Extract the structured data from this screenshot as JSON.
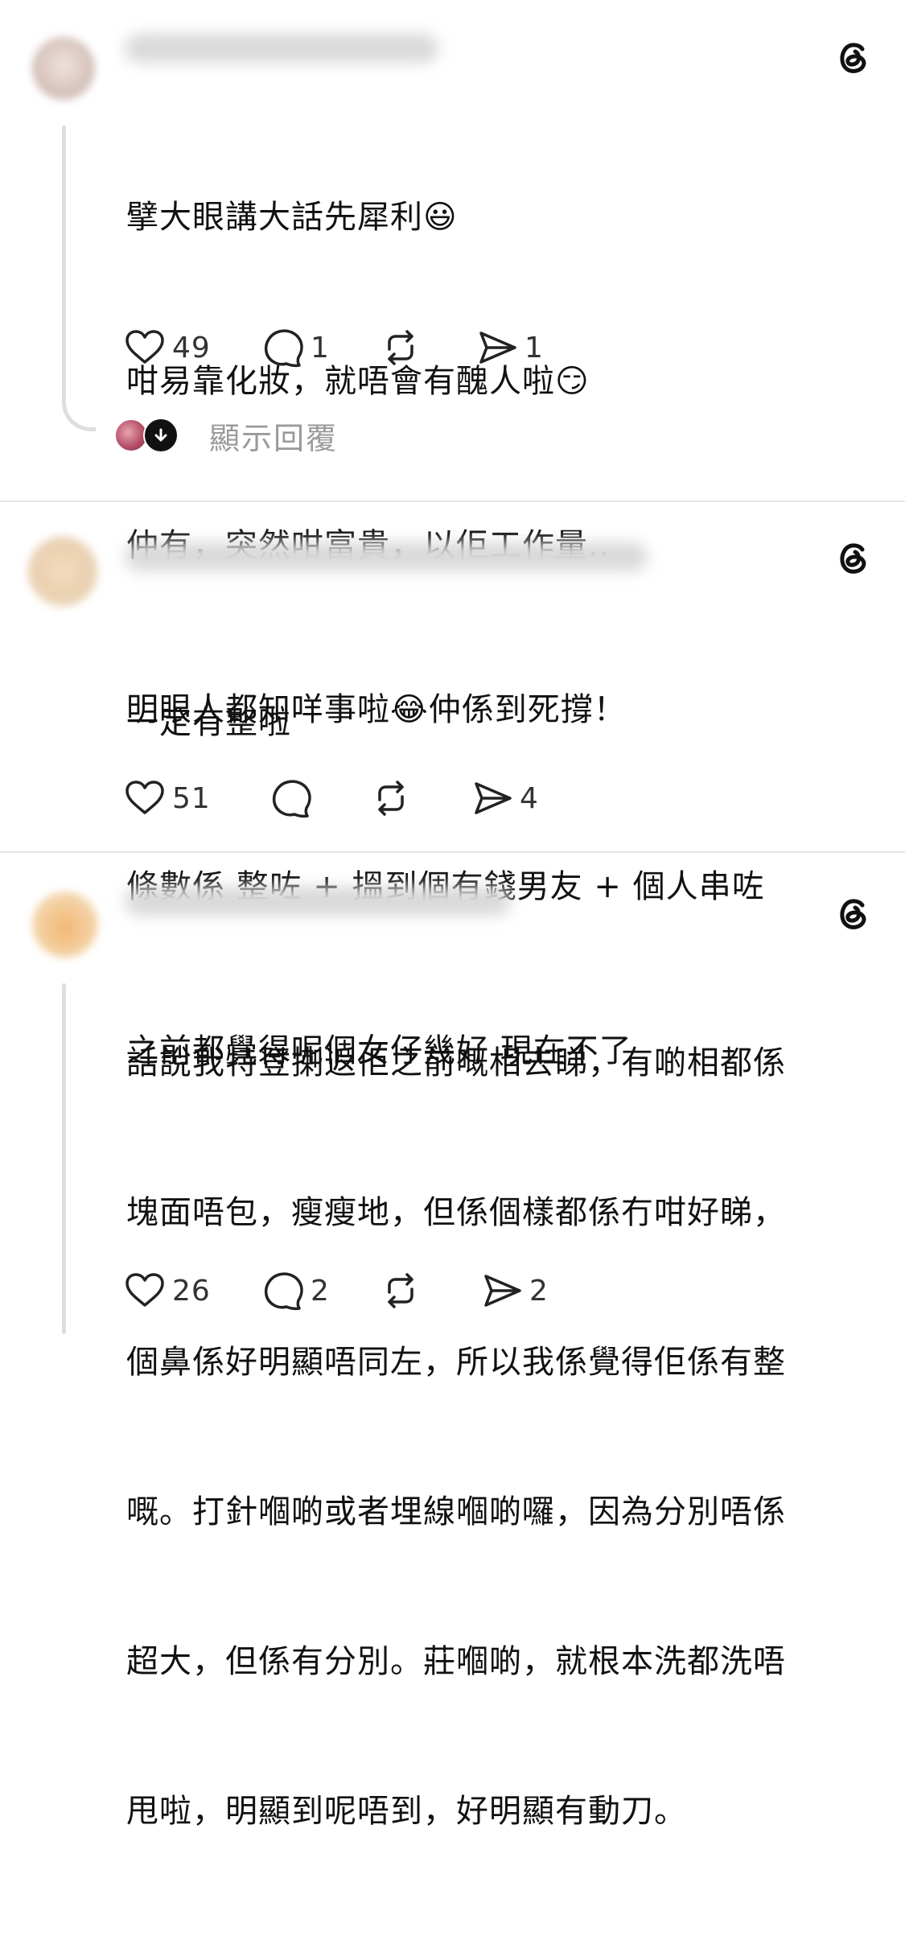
{
  "icons": {
    "threads": "threads-logo-icon",
    "like": "heart-icon",
    "reply": "comment-bubble-icon",
    "repost": "repost-icon",
    "share": "send-icon",
    "show_replies_arrow": "arrow-down-icon"
  },
  "colors": {
    "text": "#111111",
    "secondary": "#9a9a9a",
    "divider": "#e6e6e6"
  },
  "posts": [
    {
      "lines": [
        "擘大眼講大話先犀利😃",
        "咁易靠化妝，就唔會有醜人啦😏",
        "仲有，突然咁富貴，以佢工作量..",
        "明眼人都知咩事啦😂仲係到死撐！"
      ],
      "likes": "49",
      "replies": "1",
      "reposts": "",
      "shares": "1",
      "show_replies": "顯示回覆"
    },
    {
      "lines": [
        "一定有整啦",
        "條數係 整咗 + 搵到個有錢男友 + 個人串咗",
        "之前都覺得呢個女仔幾好 現在不了"
      ],
      "likes": "51",
      "replies": "",
      "reposts": "",
      "shares": "4"
    },
    {
      "lines": [
        "話說我特登揦返佢之前嘅相去睇，有啲相都係",
        "塊面唔包，瘦瘦地，但係個樣都係冇咁好睇，",
        "個鼻係好明顯唔同左，所以我係覺得佢係有整",
        "嘅。打針嗰啲或者埋線嗰啲囉，因為分別唔係",
        "超大，但係有分別。莊嗰啲，就根本洗都洗唔",
        "甩啦，明顯到呢唔到，好明顯有動刀。"
      ],
      "likes": "26",
      "replies": "2",
      "reposts": "",
      "shares": "2"
    }
  ]
}
